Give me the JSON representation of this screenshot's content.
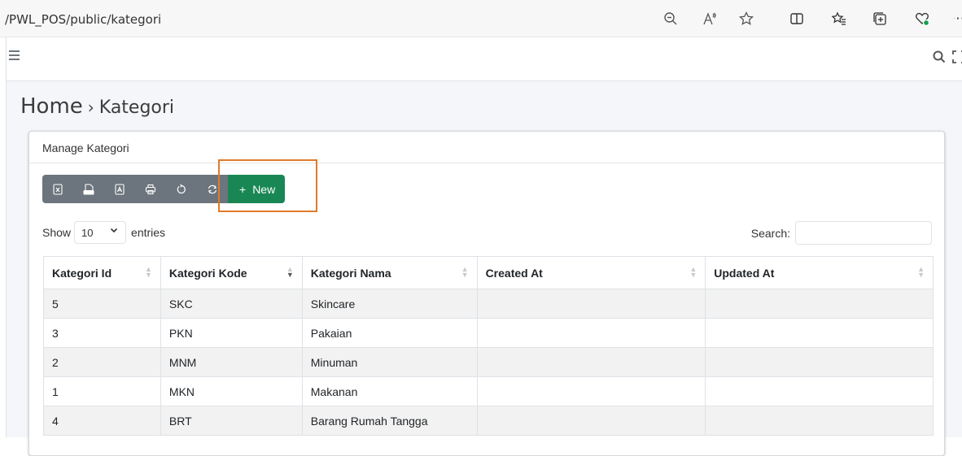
{
  "browser": {
    "url": "/PWL_POS/public/kategori"
  },
  "page": {
    "home": "Home",
    "separator": "›",
    "crumb": "Kategori"
  },
  "card": {
    "title": "Manage Kategori",
    "new_label": "New",
    "new_icon": "+"
  },
  "toolbar": {
    "buttons": [
      "excel-icon",
      "csv-icon",
      "pdf-icon",
      "print-icon",
      "reload-icon",
      "refresh-icon"
    ]
  },
  "length": {
    "show": "Show",
    "value": "10",
    "entries": "entries"
  },
  "search": {
    "label": "Search:"
  },
  "table": {
    "headers": [
      "Kategori Id",
      "Kategori Kode",
      "Kategori Nama",
      "Created At",
      "Updated At"
    ],
    "rows": [
      [
        "5",
        "SKC",
        "Skincare",
        "",
        ""
      ],
      [
        "3",
        "PKN",
        "Pakaian",
        "",
        ""
      ],
      [
        "2",
        "MNM",
        "Minuman",
        "",
        ""
      ],
      [
        "1",
        "MKN",
        "Makanan",
        "",
        ""
      ],
      [
        "4",
        "BRT",
        "Barang Rumah Tangga",
        "",
        ""
      ]
    ]
  },
  "colors": {
    "new_button": "#198754",
    "toolbar": "#6c757d",
    "highlight": "#e07b2a"
  }
}
